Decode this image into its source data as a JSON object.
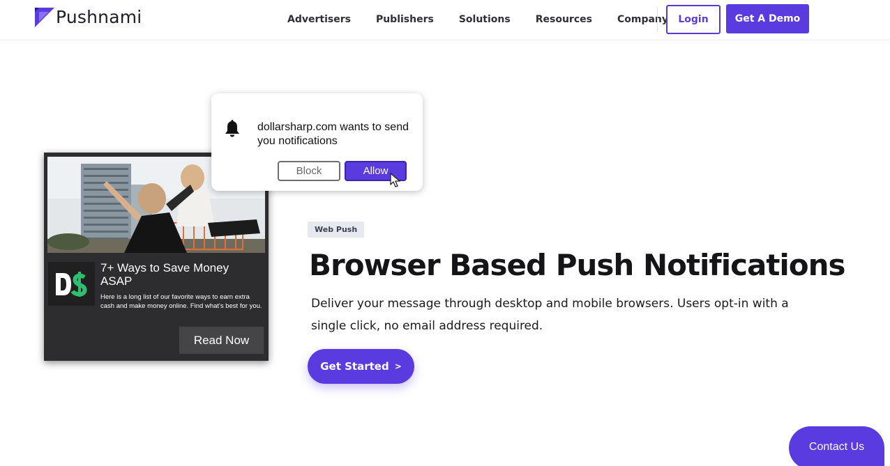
{
  "header": {
    "brand": "Pushnami",
    "nav": [
      "Advertisers",
      "Publishers",
      "Solutions",
      "Resources",
      "Company"
    ],
    "login_label": "Login",
    "demo_label": "Get A Demo"
  },
  "permission_prompt": {
    "message": "dollarsharp.com wants to send you notifications",
    "block_label": "Block",
    "allow_label": "Allow"
  },
  "notification_card": {
    "logo_text": "D$",
    "title": "7+ Ways to Save Money ASAP",
    "description": "Here is a long list of our favorite ways to earn extra cash and make money online. Find what's best for you.",
    "cta_label": "Read Now"
  },
  "hero": {
    "badge": "Web Push",
    "headline_regular": "Browser Based ",
    "headline_bold": "Push Notifications",
    "description": "Deliver your message through desktop and mobile browsers. Users opt-in with a single click, no email address required.",
    "cta_label": "Get Started",
    "cta_chevron": ">"
  },
  "contact_label": "Contact Us",
  "colors": {
    "brand_purple": "#5a3be0",
    "text_dark": "#1b1b1b",
    "card_bg": "#2d2c2e",
    "dollar_green": "#2fbf71"
  }
}
